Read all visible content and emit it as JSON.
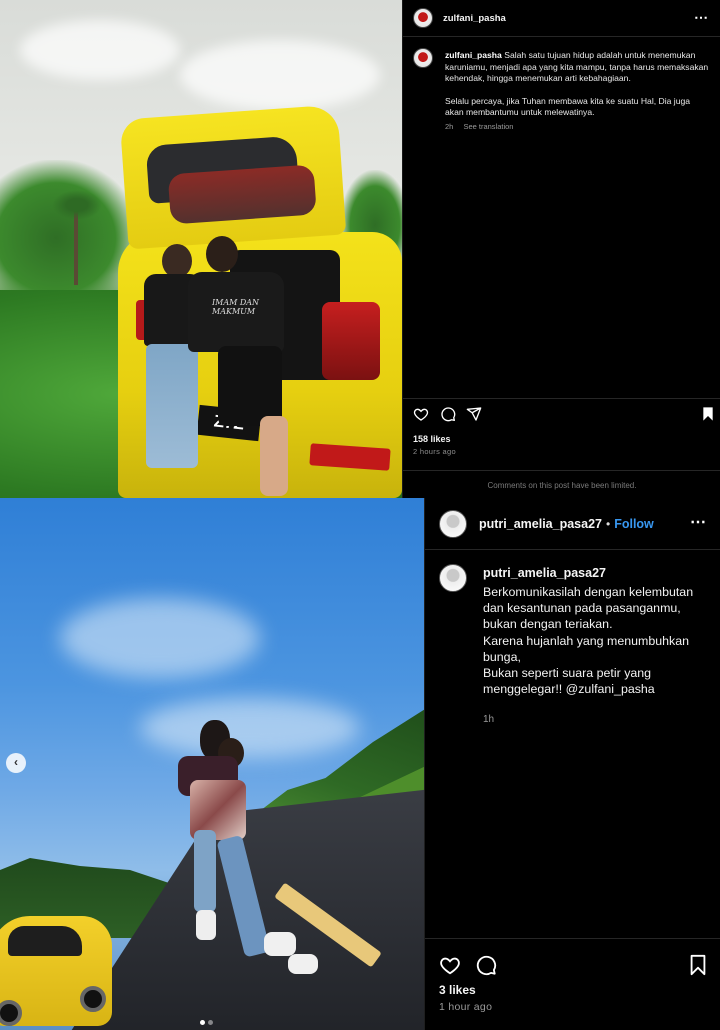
{
  "post1": {
    "header": {
      "username": "zulfani_pasha",
      "more_label": "⋯"
    },
    "photo": {
      "plate_text": "Z7Z",
      "shirt_text": "IMAM DAN MAKMUM"
    },
    "caption": {
      "username": "zulfani_pasha",
      "paragraph1": "Salah satu tujuan hidup adalah untuk menemukan karuniamu, menjadi apa yang kita mampu, tanpa harus memaksakan kehendak, hingga menemukan arti kebahagiaan.",
      "paragraph2": "Selalu percaya, jika Tuhan membawa kita ke suatu Hal, Dia juga akan membantumu untuk melewatinya.",
      "time": "2h",
      "translate_label": "See translation"
    },
    "actions": {
      "like_icon": "heart-icon",
      "comment_icon": "comment-icon",
      "share_icon": "share-icon",
      "save_icon": "bookmark-icon"
    },
    "likes": "158 likes",
    "posted": "2 hours ago",
    "limited_notice": "Comments on this post have been limited."
  },
  "post2": {
    "header": {
      "username": "putri_amelia_pasa27",
      "separator": "•",
      "follow_label": "Follow",
      "more_label": "⋯"
    },
    "caption": {
      "username": "putri_amelia_pasa27",
      "lines": [
        "Berkomunikasilah dengan kelembutan dan kesantunan pada pasanganmu, bukan dengan teriakan.",
        "Karena hujanlah yang menumbuhkan bunga,",
        "Bukan seperti suara petir yang menggelegar!! @zulfani_pasha"
      ],
      "time": "1h"
    },
    "carousel": {
      "prev_label": "‹",
      "total_slides": 2,
      "active_slide": 1
    },
    "actions": {
      "like_icon": "heart-icon",
      "comment_icon": "comment-icon",
      "save_icon": "bookmark-icon"
    },
    "likes": "3 likes",
    "posted": "1 hour ago"
  },
  "colors": {
    "link_blue": "#3897f0",
    "background": "#000000",
    "car_yellow": "#f4e21a"
  }
}
